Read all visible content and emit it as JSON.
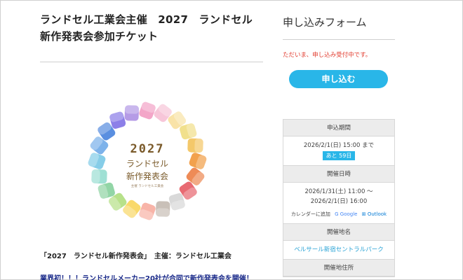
{
  "event": {
    "title_line1": "ランドセル工業会主催　2027　ランドセル",
    "title_line2": "新作発表会参加チケット",
    "summary": "「2027　ランドセル新作発表会」　主催：ランドセル工業会",
    "notice": "業界初！！！ランドセルメーカー20社が合同で新作発表会を開催！"
  },
  "logo": {
    "year": "2027",
    "line1": "ランドセル",
    "line2": "新作発表会",
    "sub": "主催 ランドセル工業会",
    "colors": [
      "#f3a6c8",
      "#f7c6d9",
      "#f9e3a8",
      "#f1e08c",
      "#f4c86a",
      "#f2a14d",
      "#ee8b57",
      "#e86a72",
      "#d9d9d9",
      "#c9c0b8",
      "#f8b4a8",
      "#f9d96b",
      "#b7e18a",
      "#92d5a6",
      "#9fe0d4",
      "#86cde8",
      "#7db2ea",
      "#5a8fe0",
      "#8c7fe8",
      "#b59be6"
    ]
  },
  "form": {
    "title": "申し込みフォーム",
    "status": "ただいま、申し込み受付中です。",
    "apply_label": "申し込む"
  },
  "info": {
    "period_head": "申込期間",
    "period_value": "2026/2/1(日) 15:00 まで",
    "days_left": "あと 59日",
    "datetime_head": "開催日時",
    "datetime_start": "2026/1/31(土) 11:00 ～",
    "datetime_end": "2026/2/1(日) 16:00",
    "calendar_label": "カレンダーに追加",
    "google_label": "Google",
    "outlook_label": "Outlook",
    "venue_head": "開催地名",
    "venue_name": "ベルサール新宿セントラルパーク",
    "address_head": "開催地住所"
  }
}
